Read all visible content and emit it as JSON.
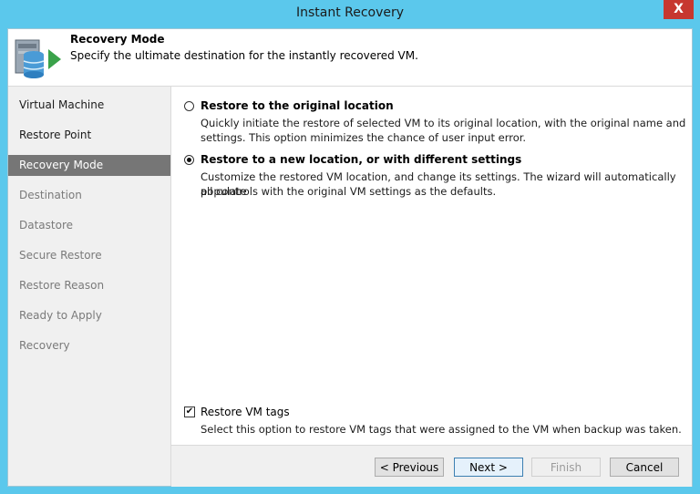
{
  "window": {
    "title": "Instant Recovery",
    "close_glyph": "X"
  },
  "header": {
    "icon": "server-database-restore-icon",
    "title": "Recovery Mode",
    "subtitle": "Specify the ultimate destination for the instantly recovered VM."
  },
  "steps": [
    {
      "label": "Virtual Machine",
      "state": "done"
    },
    {
      "label": "Restore Point",
      "state": "done"
    },
    {
      "label": "Recovery Mode",
      "state": "active"
    },
    {
      "label": "Destination",
      "state": "pending"
    },
    {
      "label": "Datastore",
      "state": "pending"
    },
    {
      "label": "Secure Restore",
      "state": "pending"
    },
    {
      "label": "Restore Reason",
      "state": "pending"
    },
    {
      "label": "Ready to Apply",
      "state": "pending"
    },
    {
      "label": "Recovery",
      "state": "pending"
    }
  ],
  "options": [
    {
      "title": "Restore to the original location",
      "desc_line1": "Quickly initiate the restore of selected VM to its original location, with the original name and",
      "desc_line2": "settings. This option minimizes the chance of user input error.",
      "selected": false
    },
    {
      "title": "Restore to a new location, or with different settings",
      "desc_line1": "Customize the restored VM location, and change its settings. The wizard will automatically populate",
      "desc_line2": "all controls with the original VM settings as the defaults.",
      "selected": true
    }
  ],
  "restore_tags": {
    "label": "Restore VM tags",
    "checked": true,
    "check_glyph": "✔",
    "desc": "Select this option to restore VM tags that were assigned to the VM when backup was taken."
  },
  "buttons": {
    "previous": "< Previous",
    "next": "Next >",
    "finish": "Finish",
    "cancel": "Cancel"
  },
  "colors": {
    "titlebar": "#5bc8ec",
    "active_step": "#767676",
    "close": "#c7372f",
    "icon_green": "#3aa24a"
  }
}
